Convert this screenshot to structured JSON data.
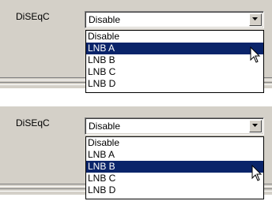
{
  "panels": [
    {
      "label": "DiSEqC",
      "value": "Disable",
      "options": [
        "Disable",
        "LNB A",
        "LNB B",
        "LNB C",
        "LNB D"
      ],
      "highlighted": "LNB A"
    },
    {
      "label": "DiSEqC",
      "value": "Disable",
      "options": [
        "Disable",
        "LNB A",
        "LNB B",
        "LNB C",
        "LNB D"
      ],
      "highlighted": "LNB B"
    }
  ],
  "icons": {
    "dropdown": "chevron-down-icon",
    "cursor": "mouse-pointer-icon"
  },
  "colors": {
    "panel_bg": "#d4d0c8",
    "highlight_bg": "#0a246a",
    "highlight_text": "#ffffff"
  }
}
